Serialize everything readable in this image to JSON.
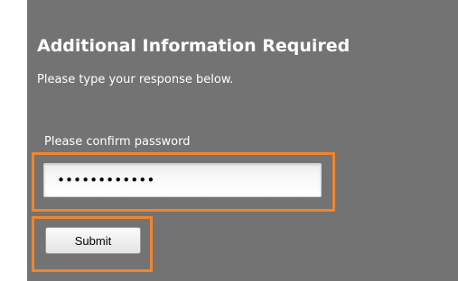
{
  "dialog": {
    "title": "Additional Information Required",
    "subtitle": "Please type your response below."
  },
  "form": {
    "password_label": "Please confirm password",
    "password_value": "••••••••••••",
    "submit_label": "Submit"
  },
  "colors": {
    "panel_bg": "#737373",
    "highlight": "#f0852d"
  }
}
